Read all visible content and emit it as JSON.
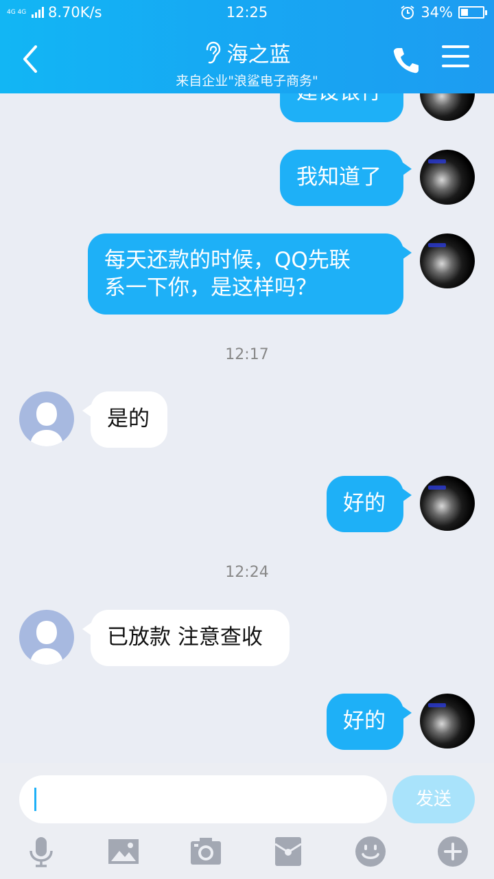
{
  "status_bar": {
    "network": "4G 4G",
    "speed": "8.70K/s",
    "time": "12:25",
    "battery": "34%",
    "battery_level": 0.34
  },
  "header": {
    "title": "海之蓝",
    "subtitle": "来自企业\"浪鲨电子商务\"",
    "background_color": "#17a7f3"
  },
  "messages": [
    {
      "side": "out",
      "text": "建设银行"
    },
    {
      "side": "out",
      "text": "我知道了"
    },
    {
      "side": "out",
      "lines": [
        "每天还款的时候，QQ先联",
        "系一下你，是这样吗？"
      ]
    },
    {
      "type": "time",
      "text": "12:17"
    },
    {
      "side": "in",
      "text": "是的"
    },
    {
      "side": "out",
      "text": "好的"
    },
    {
      "type": "time",
      "text": "12:24"
    },
    {
      "side": "in",
      "text": "已放款 注意查收"
    },
    {
      "side": "out",
      "text": "好的"
    }
  ],
  "input": {
    "value": "",
    "send_label": "发送"
  },
  "toolbar": {
    "items": [
      "voice-icon",
      "image-icon",
      "camera-icon",
      "red-packet-icon",
      "emoji-icon",
      "plus-icon"
    ]
  },
  "colors": {
    "bubble_out": "#1eb0f7",
    "bubble_in": "#ffffff",
    "chat_background": "#eaedf4",
    "icon_gray": "#a3a8b3"
  }
}
